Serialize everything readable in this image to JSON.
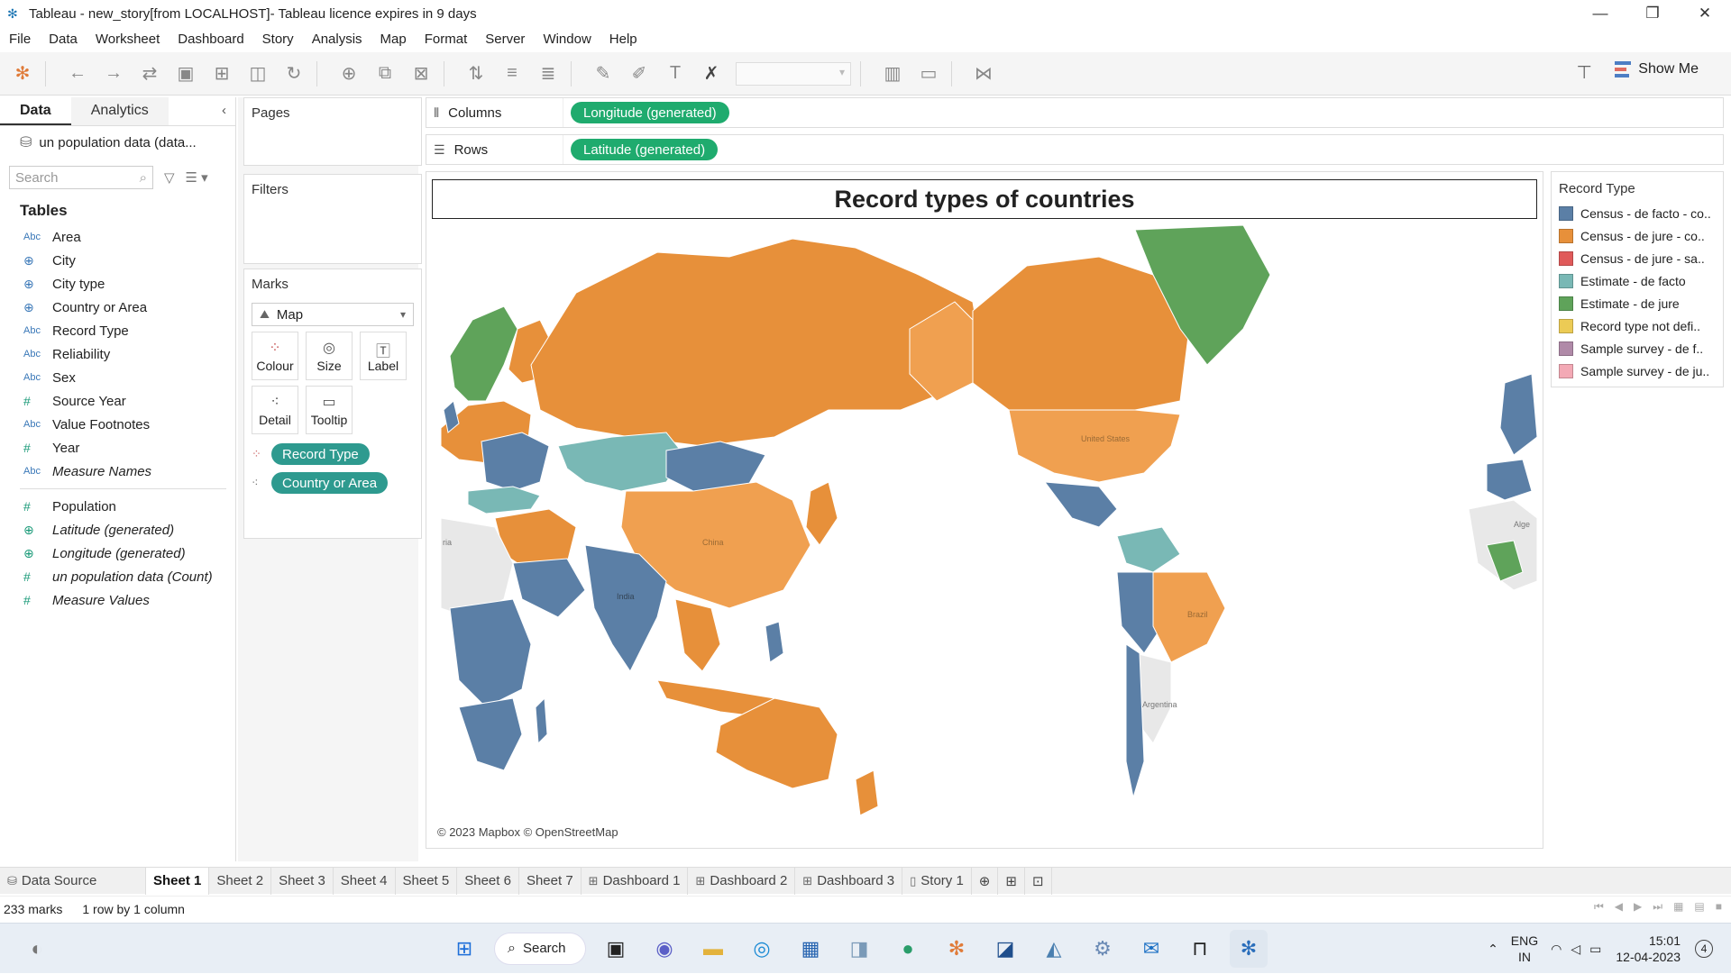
{
  "window": {
    "title": "Tableau - new_story[from LOCALHOST]- Tableau licence expires in 9 days",
    "minimize": "—",
    "restore": "❐",
    "close": "✕"
  },
  "menu": [
    "File",
    "Data",
    "Worksheet",
    "Dashboard",
    "Story",
    "Analysis",
    "Map",
    "Format",
    "Server",
    "Window",
    "Help"
  ],
  "toolbar": {
    "show_me": "Show Me"
  },
  "datapane": {
    "tab_data": "Data",
    "tab_analytics": "Analytics",
    "datasource": "un population data (data...",
    "search_placeholder": "Search",
    "tables_header": "Tables",
    "fields": [
      {
        "type": "Abc",
        "label": "Area"
      },
      {
        "type": "⊕",
        "label": "City"
      },
      {
        "type": "⊕",
        "label": "City type"
      },
      {
        "type": "⊕",
        "label": "Country or Area"
      },
      {
        "type": "Abc",
        "label": "Record Type"
      },
      {
        "type": "Abc",
        "label": "Reliability"
      },
      {
        "type": "Abc",
        "label": "Sex"
      },
      {
        "type": "#",
        "label": "Source Year"
      },
      {
        "type": "Abc",
        "label": "Value Footnotes"
      },
      {
        "type": "#",
        "label": "Year"
      },
      {
        "type": "Abc",
        "label": "Measure Names"
      }
    ],
    "measures": [
      {
        "type": "#",
        "label": "Population"
      },
      {
        "type": "⊕",
        "label": "Latitude (generated)"
      },
      {
        "type": "⊕",
        "label": "Longitude (generated)"
      },
      {
        "type": "#",
        "label": "un population data (Count)"
      },
      {
        "type": "#",
        "label": "Measure Values"
      }
    ]
  },
  "cards": {
    "pages": "Pages",
    "filters": "Filters",
    "marks": "Marks",
    "mark_type": "Map",
    "mark_buttons": [
      "Colour",
      "Size",
      "Label",
      "Detail",
      "Tooltip"
    ],
    "pill_color": "Record Type",
    "pill_detail": "Country or Area"
  },
  "shelves": {
    "columns_label": "Columns",
    "columns_pill": "Longitude (generated)",
    "rows_label": "Rows",
    "rows_pill": "Latitude (generated)"
  },
  "viz": {
    "title": "Record types of countries",
    "attribution": "© 2023 Mapbox © OpenStreetMap",
    "map_labels": [
      "China",
      "United States",
      "Brazil",
      "Argentina",
      "India",
      "Alge",
      "ria"
    ]
  },
  "legend": {
    "title": "Record Type",
    "items": [
      {
        "label": "Census - de facto - co..",
        "color": "#5b7fa6"
      },
      {
        "label": "Census - de jure - co..",
        "color": "#e7903a"
      },
      {
        "label": "Census - de jure - sa..",
        "color": "#e05a5a"
      },
      {
        "label": "Estimate - de facto",
        "color": "#79b8b5"
      },
      {
        "label": "Estimate - de jure",
        "color": "#5fa35a"
      },
      {
        "label": "Record type not defi..",
        "color": "#eccb55"
      },
      {
        "label": "Sample survey - de f..",
        "color": "#b08aa8"
      },
      {
        "label": "Sample survey - de ju..",
        "color": "#f3a9b5"
      }
    ]
  },
  "sheet_tabs": {
    "data_source": "Data Source",
    "tabs": [
      "Sheet 1",
      "Sheet 2",
      "Sheet 3",
      "Sheet 4",
      "Sheet 5",
      "Sheet 6",
      "Sheet 7",
      "Dashboard 1",
      "Dashboard 2",
      "Dashboard 3",
      "Story 1"
    ],
    "active": "Sheet 1"
  },
  "status": {
    "marks": "233 marks",
    "dims": "1 row by 1 column"
  },
  "taskbar": {
    "search": "Search",
    "lang1": "ENG",
    "lang2": "IN",
    "time": "15:01",
    "date": "12-04-2023",
    "notifications": "4"
  }
}
